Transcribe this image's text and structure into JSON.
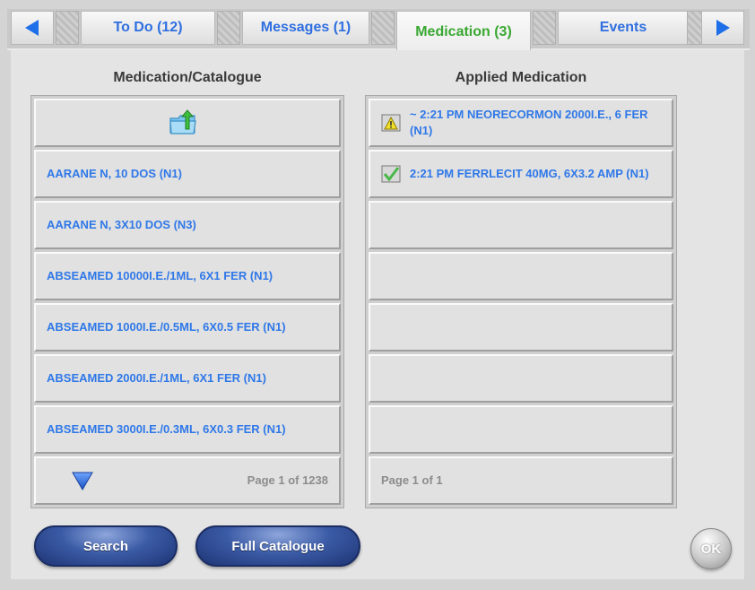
{
  "tabs": [
    {
      "label": "To Do (12)",
      "active": false
    },
    {
      "label": "Messages (1)",
      "active": false
    },
    {
      "label": "Medication (3)",
      "active": true
    },
    {
      "label": "Events",
      "active": false
    }
  ],
  "nav": {
    "prev_icon": "triangle-left-icon",
    "next_icon": "triangle-right-icon"
  },
  "catalogue": {
    "title": "Medication/Catalogue",
    "up_icon": "folder-up-icon",
    "items": [
      "AARANE N, 10 DOS (N1)",
      "AARANE N, 3X10 DOS (N3)",
      "ABSEAMED 10000I.E./1ML, 6X1 FER (N1)",
      "ABSEAMED 1000I.E./0.5ML, 6X0.5 FER (N1)",
      "ABSEAMED 2000I.E./1ML, 6X1 FER (N1)",
      "ABSEAMED 3000I.E./0.3ML, 6X0.3 FER (N1)"
    ],
    "down_icon": "triangle-down-icon",
    "pager": "Page 1 of 1238"
  },
  "applied": {
    "title": "Applied Medication",
    "items": [
      {
        "icon": "warning-icon",
        "text": "~ 2:21 PM NEORECORMON 2000I.E., 6 FER (N1)"
      },
      {
        "icon": "checkmark-icon",
        "text": "2:21 PM FERRLECIT 40MG, 6X3.2 AMP (N1)"
      }
    ],
    "pager": "Page 1 of 1"
  },
  "buttons": {
    "search": "Search",
    "full_catalogue": "Full Catalogue",
    "ok": "OK"
  },
  "colors": {
    "link_blue": "#2f78e8",
    "active_tab_green": "#3aa832",
    "button_blue": "#3b5ba6"
  }
}
